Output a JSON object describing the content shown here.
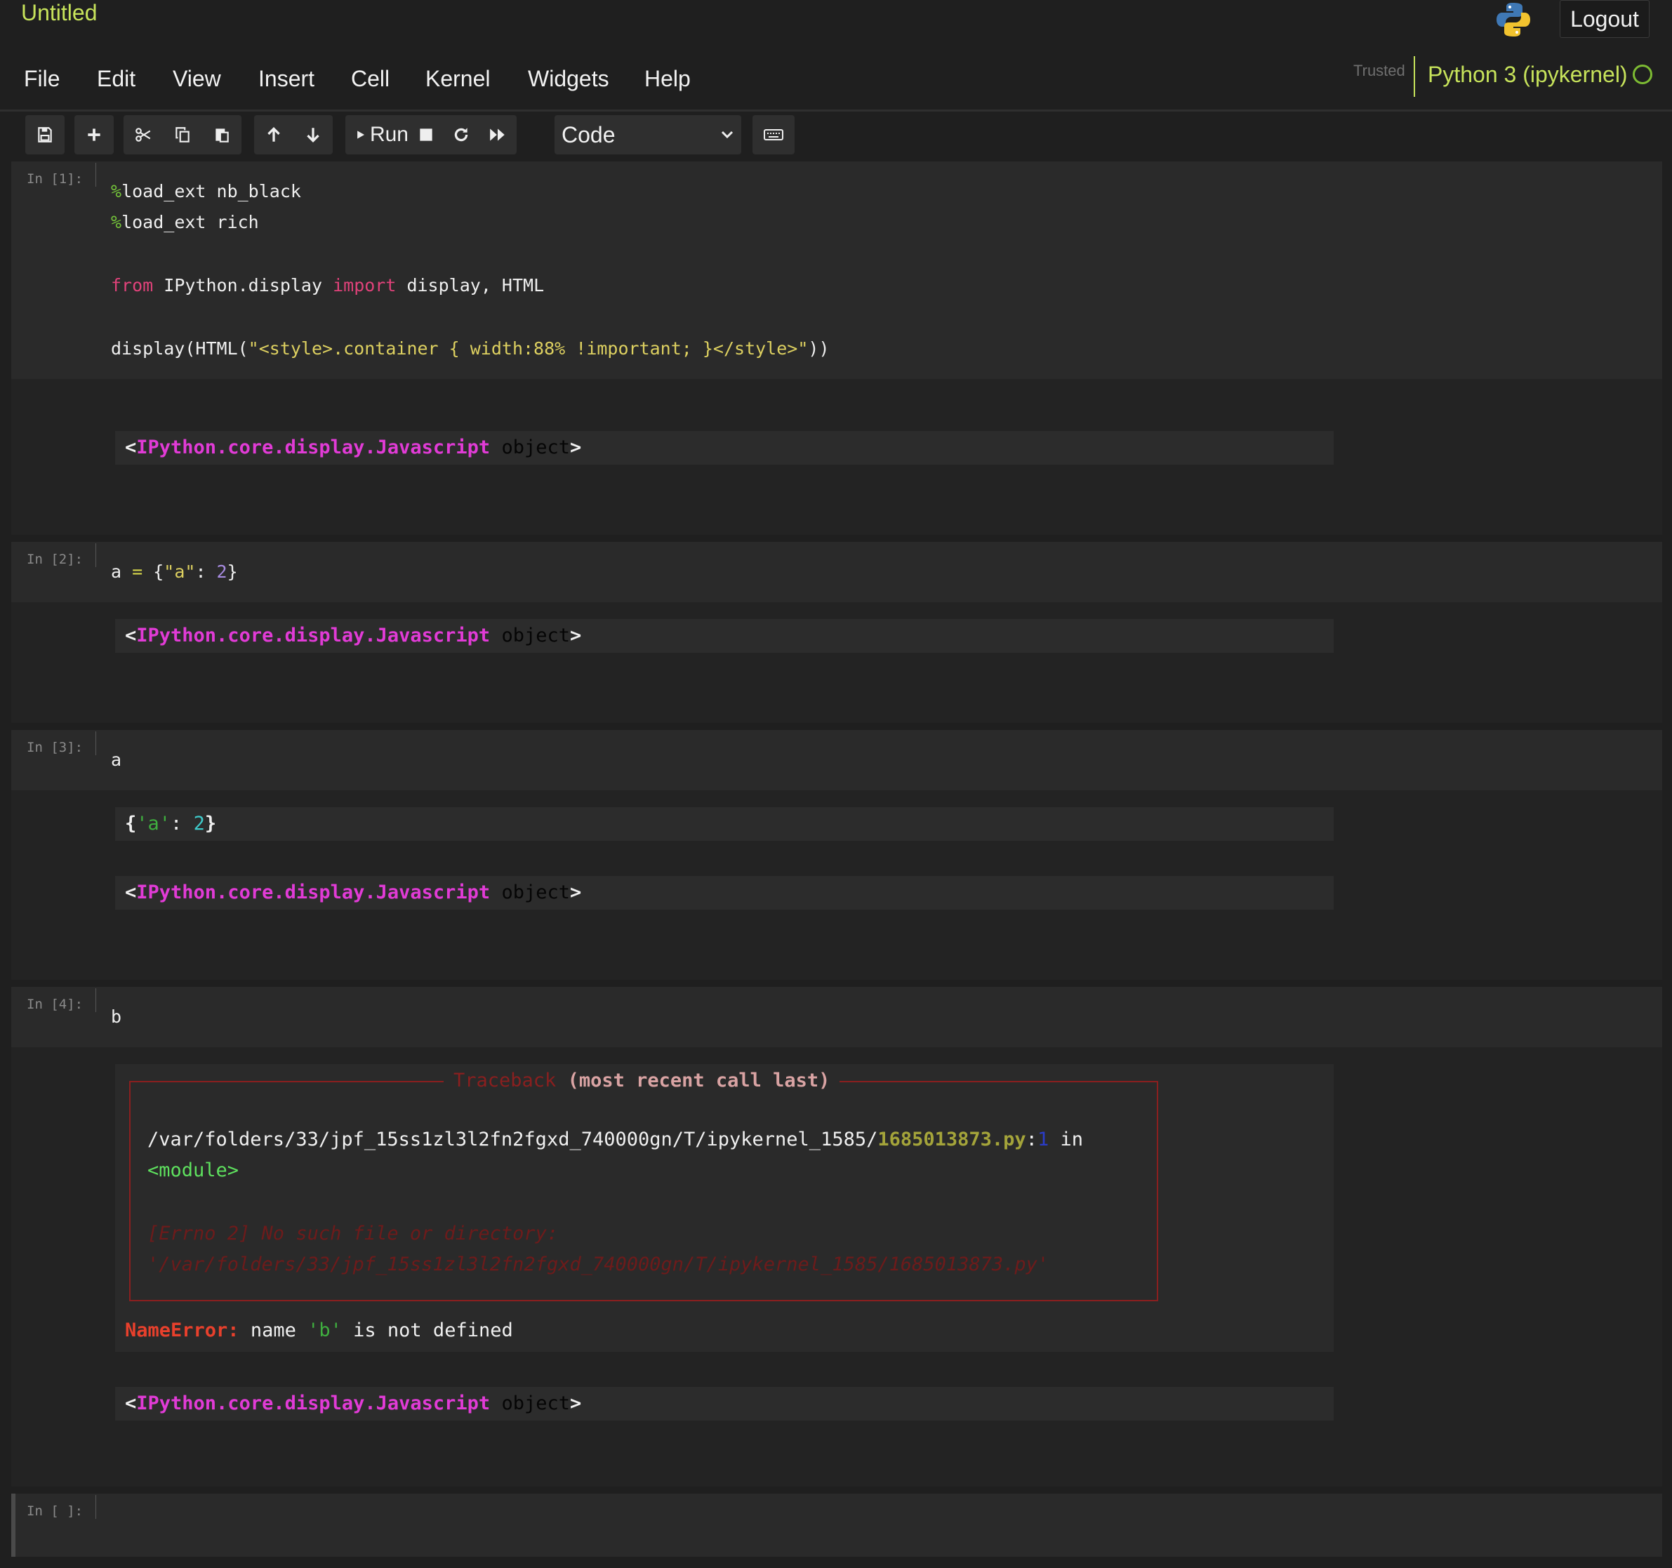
{
  "header": {
    "notebook_title": "Untitled",
    "logout_label": "Logout",
    "trusted_label": "Trusted",
    "kernel_name": "Python 3 (ipykernel)"
  },
  "menu": [
    "File",
    "Edit",
    "View",
    "Insert",
    "Cell",
    "Kernel",
    "Widgets",
    "Help"
  ],
  "toolbar": {
    "run_label": "Run",
    "cell_type": "Code",
    "icons": [
      "save-icon",
      "plus-icon",
      "cut-icon",
      "copy-icon",
      "paste-icon",
      "arrow-up-icon",
      "arrow-down-icon",
      "play-icon",
      "stop-icon",
      "restart-icon",
      "fast-forward-icon",
      "keyboard-icon"
    ]
  },
  "cells": {
    "c1": {
      "prompt": "In [1]:",
      "line1_pct": "%",
      "line1_rest": "load_ext nb_black",
      "line2_pct": "%",
      "line2_rest": "load_ext rich",
      "line3_from": "from",
      "line3_mod": " IPython.display ",
      "line3_import": "import",
      "line3_rest": " display, HTML",
      "line4_fn": "display(HTML(",
      "line4_str": "\"<style>.container { width:88% !important; }</style>\"",
      "line4_close": "))",
      "out_lt": "<",
      "out_cls": "IPython.core.display.Javascript",
      "out_obj": " object",
      "out_gt": ">"
    },
    "c2": {
      "prompt": "In [2]:",
      "code_a": "a ",
      "code_eq": "=",
      "code_open": " {",
      "code_key": "\"a\"",
      "code_colon": ": ",
      "code_val": "2",
      "code_close": "}",
      "out_lt": "<",
      "out_cls": "IPython.core.display.Javascript",
      "out_obj": " object",
      "out_gt": ">"
    },
    "c3": {
      "prompt": "In [3]:",
      "code": "a",
      "res_open": "{",
      "res_key": "'a'",
      "res_colon": ": ",
      "res_val": "2",
      "res_close": "}",
      "out_lt": "<",
      "out_cls": "IPython.core.display.Javascript",
      "out_obj": " object",
      "out_gt": ">"
    },
    "c4": {
      "prompt": "In [4]:",
      "code": "b",
      "tb_title_red": "Traceback",
      "tb_title_rest": " (most recent call last)",
      "tb_path": "/var/folders/33/jpf_15ss1zl3l2fn2fgxd_740000gn/T/ipykernel_1585/",
      "tb_file": "1685013873.py",
      "tb_colon": ":",
      "tb_lineno": "1",
      "tb_in": " in",
      "tb_module": "<module>",
      "tb_err1": "[Errno 2] No such file or directory:",
      "tb_err2": "'/var/folders/33/jpf_15ss1zl3l2fn2fgxd_740000gn/T/ipykernel_1585/1685013873.py'",
      "err_name": "NameError:",
      "err_msg1": " name ",
      "err_var": "'b'",
      "err_msg2": " is not defined",
      "out_lt": "<",
      "out_cls": "IPython.core.display.Javascript",
      "out_obj": " object",
      "out_gt": ">"
    },
    "c5": {
      "prompt": "In [ ]:"
    }
  }
}
